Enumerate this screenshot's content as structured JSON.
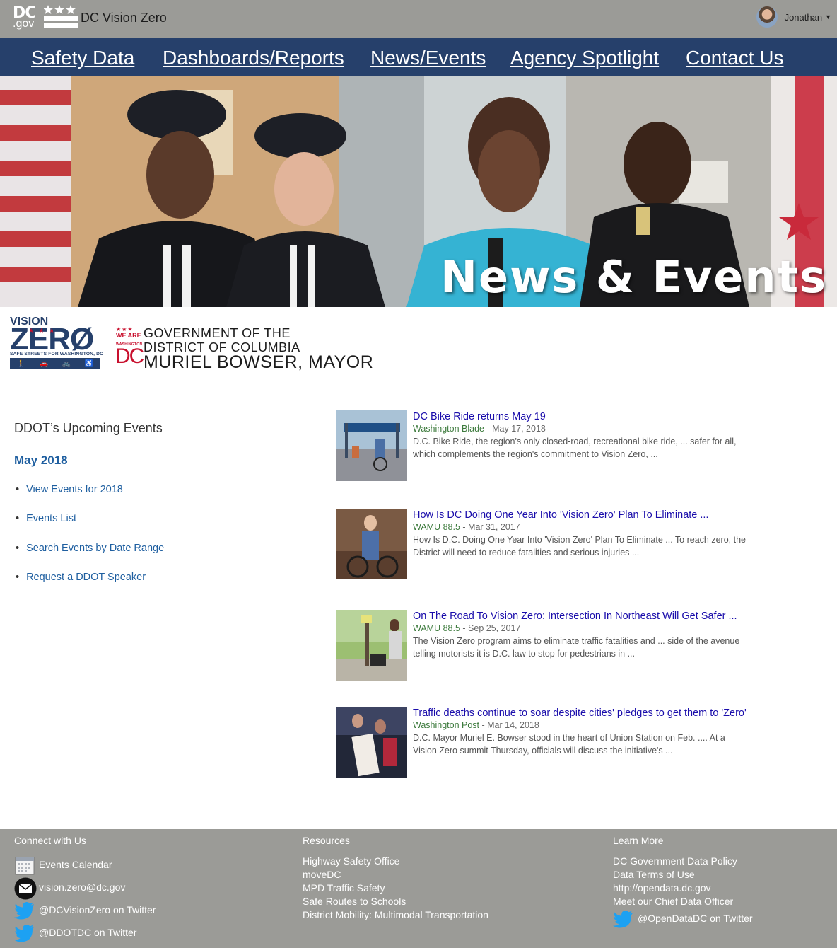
{
  "header": {
    "logo_letters": "DC",
    "logo_suffix": ".gov",
    "app_title": "DC Vision Zero",
    "user_name": "Jonathan"
  },
  "nav": {
    "items": [
      "Safety Data",
      "Dashboards/Reports",
      "News/Events",
      "Agency Spotlight",
      "Contact Us"
    ]
  },
  "hero": {
    "title": "News & Events"
  },
  "logos": {
    "vision_zero": {
      "line1": "VISION",
      "line2": "ZERØ",
      "tagline": "SAFE STREETS FOR WASHINGTON, DC"
    },
    "government": {
      "we_are": "WE ARE",
      "washington": "WASHINGTON",
      "dc": "DC",
      "line1": "GOVERNMENT OF THE",
      "line2": "DISTRICT OF COLUMBIA",
      "line3": "MURIEL BOWSER, MAYOR"
    }
  },
  "events": {
    "heading": "DDOT’s Upcoming Events",
    "month": "May 2018",
    "links": [
      "View Events for 2018",
      "Events List",
      "Search Events by Date Range",
      "Request a DDOT Speaker"
    ]
  },
  "news": [
    {
      "title": "DC Bike Ride returns May 19",
      "source": "Washington Blade",
      "date": " - May 17, 2018",
      "snippet1": "D.C. Bike Ride, the region's only closed-road, recreational bike ride, ... safer for all,",
      "snippet2": "which complements the region's commitment to Vision Zero, ..."
    },
    {
      "title": "How Is DC Doing One Year Into 'Vision Zero' Plan To Eliminate ...",
      "source": "WAMU 88.5",
      "date": " - Mar 31, 2017",
      "snippet1": "How Is D.C. Doing One Year Into 'Vision Zero' Plan To Eliminate ... To reach zero, the",
      "snippet2": "District will need to reduce fatalities and serious injuries ..."
    },
    {
      "title": "On The Road To Vision Zero: Intersection In Northeast Will Get Safer ...",
      "source": "WAMU 88.5",
      "date": " - Sep 25, 2017",
      "snippet1": "The Vision Zero program aims to eliminate traffic fatalities and ... side of the avenue",
      "snippet2": "telling motorists it is D.C. law to stop for pedestrians in ..."
    },
    {
      "title": "Traffic deaths continue to soar despite cities' pledges to get them to 'Zero'",
      "source": "Washington Post",
      "date": " - Mar 14, 2018",
      "snippet1": "D.C. Mayor Muriel E. Bowser stood in the heart of Union Station on Feb. .... At a",
      "snippet2": "Vision Zero summit Thursday, officials will discuss the initiative's ..."
    }
  ],
  "footer": {
    "connect": {
      "heading": "Connect with Us",
      "items": [
        "Events Calendar",
        "vision.zero@dc.gov",
        "@DCVisionZero on Twitter",
        "@DDOTDC on Twitter"
      ]
    },
    "resources": {
      "heading": "Resources",
      "items": [
        "Highway Safety Office",
        "moveDC",
        "MPD Traffic Safety",
        "Safe Routes to Schools",
        "District Mobility: Multimodal Transportation"
      ]
    },
    "learn": {
      "heading": "Learn More",
      "items": [
        "DC Government Data Policy",
        "Data Terms of Use",
        "http://opendata.dc.gov",
        "Meet our Chief Data Officer"
      ],
      "twitter": "@OpenDataDC on Twitter"
    }
  },
  "colors": {
    "header_gray": "#9b9b97",
    "nav_blue": "#26406b",
    "link_blue": "#1f5fa0",
    "news_link": "#1a0dab",
    "source_green": "#3c7a3c",
    "dc_red": "#c8102e",
    "twitter_blue": "#1da1f2"
  },
  "icons": [
    "dc-flag-icon",
    "user-avatar",
    "caret-down-icon",
    "calendar-icon",
    "mail-icon",
    "twitter-icon"
  ]
}
